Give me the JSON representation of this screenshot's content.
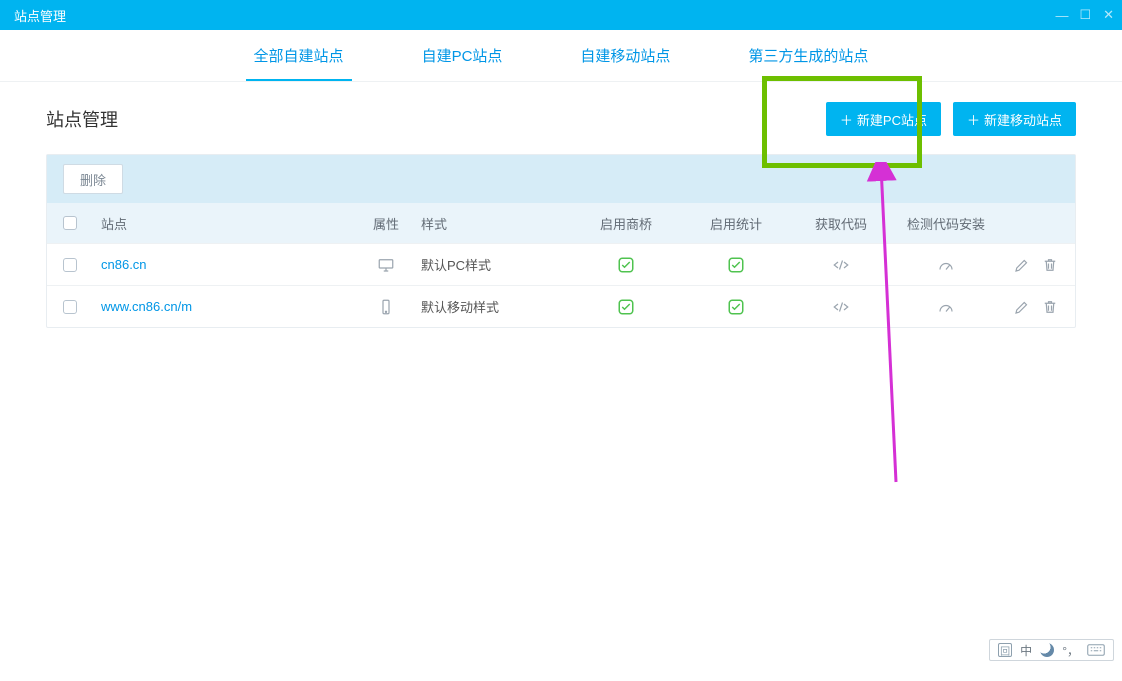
{
  "window": {
    "title": "站点管理"
  },
  "tabs": [
    {
      "label": "全部自建站点",
      "active": true
    },
    {
      "label": "自建PC站点"
    },
    {
      "label": "自建移动站点"
    },
    {
      "label": "第三方生成的站点"
    }
  ],
  "page": {
    "title": "站点管理",
    "btn_new_pc": "新建PC站点",
    "btn_new_mobile": "新建移动站点"
  },
  "toolbar": {
    "delete_label": "删除"
  },
  "table": {
    "headers": {
      "site": "站点",
      "attr": "属性",
      "style": "样式",
      "qiao": "启用商桥",
      "stat": "启用统计",
      "code": "获取代码",
      "inst": "检测代码安装"
    },
    "rows": [
      {
        "site": "cn86.cn",
        "device": "desktop",
        "style": "默认PC样式"
      },
      {
        "site": "www.cn86.cn/m",
        "device": "mobile",
        "style": "默认移动样式"
      }
    ]
  },
  "statusbar": {
    "ime": "中",
    "punct": "°，"
  }
}
